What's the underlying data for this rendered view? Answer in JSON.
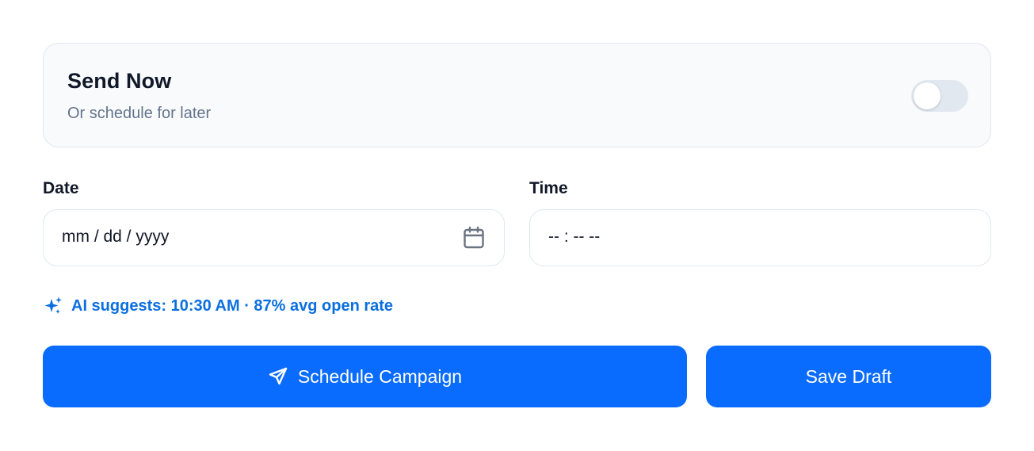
{
  "send_now": {
    "title": "Send Now",
    "subtitle": "Or schedule for later",
    "toggle_on": false
  },
  "date_field": {
    "label": "Date",
    "placeholder": "mm / dd / yyyy",
    "icon": "calendar-icon"
  },
  "time_field": {
    "label": "Time",
    "placeholder": "-- : -- --"
  },
  "ai_suggestion": {
    "icon": "sparkles-icon",
    "text": "AI suggests: 10:30 AM · 87% avg open rate"
  },
  "actions": {
    "schedule_label": "Schedule Campaign",
    "schedule_icon": "paper-plane-icon",
    "draft_label": "Save Draft"
  },
  "colors": {
    "primary": "#0a6cff",
    "accent_text": "#0b6fe0",
    "card_bg": "#f8fafc",
    "border": "#e2e8f0",
    "muted_text": "#64748b"
  }
}
